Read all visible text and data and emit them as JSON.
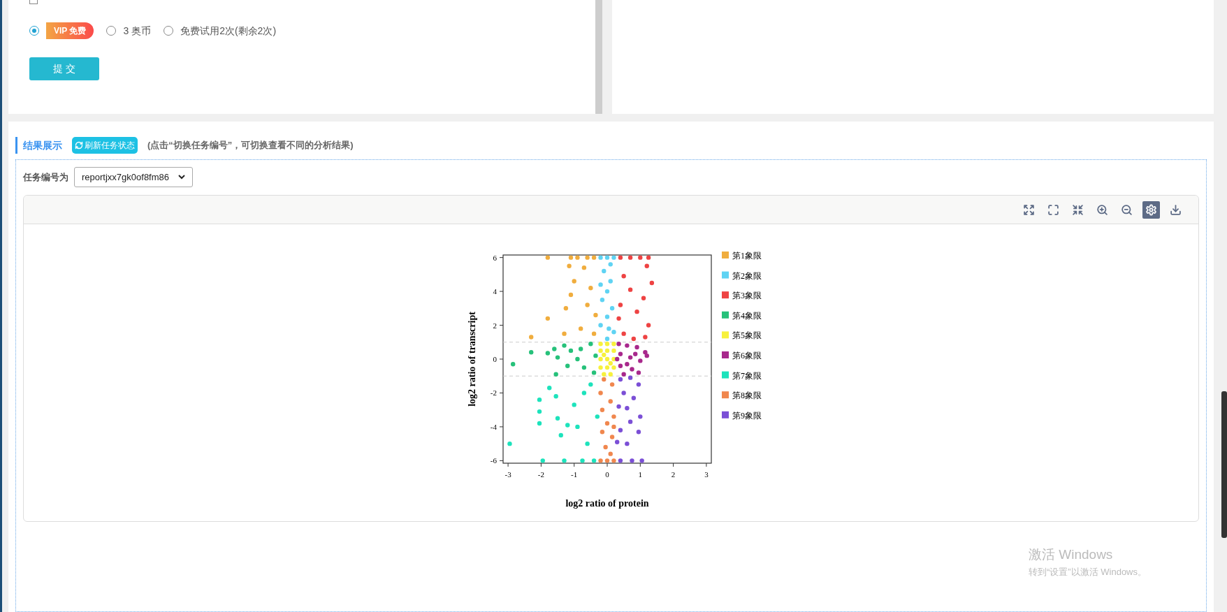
{
  "form": {
    "notify_checkbox": {
      "checked": false
    },
    "options": [
      {
        "kind": "badge",
        "label": "VIP 免费",
        "selected": true
      },
      {
        "kind": "text",
        "label": "3 奥币",
        "selected": false
      },
      {
        "kind": "text",
        "label": "免费试用2次(剩余2次)",
        "selected": false
      }
    ],
    "submit": "提 交"
  },
  "results": {
    "title": "结果展示",
    "refresh_button": "刷新任务状态",
    "hint": "(点击“切换任务编号”，可切换查看不同的分析结果)",
    "task_label": "任务编号为",
    "task_value": "reportjxx7gk0of8fm86",
    "toolbar": [
      {
        "selected": false
      },
      {
        "selected": false
      },
      {
        "selected": false
      },
      {
        "selected": false
      },
      {
        "selected": false
      },
      {
        "selected": true
      },
      {
        "selected": false
      }
    ],
    "chart_data": {
      "type": "scatter",
      "xlabel": "log2 ratio of protein",
      "ylabel": "log2 ratio of transcript",
      "xlim": [
        -3.15,
        3.15
      ],
      "ylim": [
        -6.15,
        6.15
      ],
      "xticks": [
        -3,
        -2,
        -1,
        0,
        1,
        2,
        3
      ],
      "yticks": [
        -6,
        -4,
        -2,
        0,
        2,
        4,
        6
      ],
      "ref_lines": [
        {
          "axis": "y",
          "value": 1
        },
        {
          "axis": "y",
          "value": -1
        }
      ],
      "legend": "right",
      "series": [
        {
          "name": "第1象限",
          "color": "#f0ad3e",
          "x": [
            -1.8,
            -1.1,
            -0.9,
            -0.6,
            -0.4,
            -1.15,
            -0.7,
            -0.5,
            -1.1,
            -1.25,
            -0.6,
            -1.8,
            -2.3,
            -0.8,
            -0.4,
            -1.3,
            -0.35,
            -1.0
          ],
          "values": [
            6,
            6,
            6,
            6,
            6,
            5.5,
            5.4,
            4.2,
            3.8,
            3,
            3.2,
            2.4,
            1.3,
            1.8,
            1.5,
            1.5,
            2.6,
            4.6
          ]
        },
        {
          "name": "第2象限",
          "color": "#5fd3f3",
          "x": [
            -0.2,
            0,
            0.2,
            -0.1,
            0.1,
            0,
            -0.15,
            0.15,
            0,
            -0.2,
            0.2,
            0,
            0.1,
            -0.2,
            0.05
          ],
          "values": [
            6,
            6,
            6,
            5.2,
            4.6,
            4,
            3.5,
            3,
            2.5,
            2,
            1.6,
            1.2,
            5.6,
            4.4,
            1.8
          ]
        },
        {
          "name": "第3象限",
          "color": "#ee4343",
          "x": [
            0.4,
            0.7,
            1.0,
            1.25,
            1.2,
            0.5,
            1.35,
            0.7,
            1.1,
            0.4,
            0.9,
            1.25,
            0.5,
            0.8,
            1.15,
            0.35
          ],
          "values": [
            6,
            6,
            6,
            6,
            5.5,
            4.9,
            4.5,
            4.1,
            3.6,
            3.2,
            2.8,
            2,
            1.5,
            1.2,
            1.3,
            2.4
          ]
        },
        {
          "name": "第4象限",
          "color": "#26c17a",
          "x": [
            -2.85,
            -2.3,
            -1.8,
            -1.6,
            -1.5,
            -1.3,
            -1.1,
            -0.9,
            -0.7,
            -0.5,
            -0.4,
            -1.2,
            -1.55,
            -0.8,
            -0.35
          ],
          "values": [
            -0.3,
            0.4,
            0.35,
            0.6,
            0.1,
            0.8,
            0.5,
            0,
            -0.5,
            0.9,
            -0.8,
            -0.4,
            -0.9,
            0.6,
            0.2
          ]
        },
        {
          "name": "第5象限",
          "color": "#f7f13c",
          "x": [
            -0.2,
            0,
            0.2,
            -0.2,
            0,
            0.2,
            -0.2,
            0,
            0.2,
            -0.2,
            0,
            0.2,
            -0.1,
            0.1,
            -0.1,
            0.1
          ],
          "values": [
            0.9,
            0.9,
            0.9,
            0.5,
            0.5,
            0.5,
            0,
            0,
            0,
            -0.5,
            -0.5,
            -0.5,
            -0.9,
            -0.9,
            0.25,
            -0.25
          ]
        },
        {
          "name": "第6象限",
          "color": "#a8288c",
          "x": [
            0.35,
            0.6,
            0.9,
            1.15,
            1.2,
            0.4,
            0.7,
            1.0,
            0.4,
            0.75,
            0.95,
            0.5,
            0.3,
            0.85,
            0.6
          ],
          "values": [
            0.9,
            0.8,
            0.7,
            0.4,
            0.2,
            0.3,
            0.1,
            -0.1,
            -0.4,
            -0.6,
            -0.8,
            -0.9,
            0,
            0.3,
            -0.3
          ]
        },
        {
          "name": "第7象限",
          "color": "#1de3bc",
          "x": [
            -2.95,
            -2.05,
            -2.05,
            -2.05,
            -1.75,
            -1.55,
            -1.5,
            -1.4,
            -1.2,
            -1.0,
            -0.9,
            -0.7,
            -0.6,
            -0.3,
            -1.95,
            -1.3,
            -0.75,
            -0.4,
            -0.5
          ],
          "values": [
            -5,
            -2.4,
            -3.1,
            -3.8,
            -1.7,
            -2.2,
            -3.5,
            -4.5,
            -3.9,
            -2.7,
            -4,
            -2,
            -5,
            -3.4,
            -6,
            -6,
            -6,
            -6,
            -1.5
          ]
        },
        {
          "name": "第8象限",
          "color": "#f0874e",
          "x": [
            -0.1,
            0.15,
            -0.2,
            0.1,
            -0.15,
            0.2,
            0,
            -0.15,
            0.15,
            -0.05,
            0.1,
            -0.2,
            0.2,
            0,
            0.2
          ],
          "values": [
            -1.2,
            -1.5,
            -2,
            -2.5,
            -3,
            -3.4,
            -3.8,
            -4.3,
            -4.6,
            -5.2,
            -5.6,
            -6,
            -6,
            -6,
            -4
          ]
        },
        {
          "name": "第9象限",
          "color": "#7b4fd6",
          "x": [
            0.4,
            0.7,
            0.95,
            0.5,
            0.8,
            0.35,
            0.6,
            1.0,
            0.4,
            0.7,
            0.95,
            0.3,
            0.6,
            0.4,
            0.75,
            1.05
          ],
          "values": [
            -1.2,
            -1.1,
            -1.5,
            -2,
            -2.3,
            -2.8,
            -2.9,
            -3.4,
            -4.2,
            -3.7,
            -4.3,
            -4.9,
            -5,
            -6,
            -6,
            -6
          ]
        }
      ]
    }
  },
  "activation_notice": {
    "title": "激活 Windows",
    "subtitle": "转到“设置”以激活 Windows。"
  }
}
